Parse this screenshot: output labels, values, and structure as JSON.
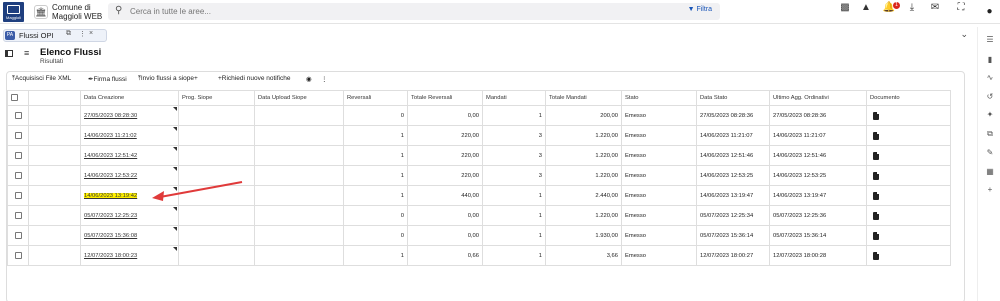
{
  "header": {
    "logo_text": "Maggioli",
    "org_line1": "Comune di",
    "org_line2": "Maggioli WEB",
    "search_placeholder": "Cerca in tutte le aree...",
    "filter_label": "Filtra",
    "notification_count": "1"
  },
  "tab": {
    "icon_text": "PA",
    "label": "Flussi OPI",
    "copy": "⧉",
    "menu": "⋮",
    "close": "×"
  },
  "page": {
    "title": "Elenco Flussi",
    "subtitle": "Risultati"
  },
  "toolbar": {
    "acquire": "Acquisisci File XML",
    "sign": "Firma flussi",
    "send": "Invio flussi a siope+",
    "request": "Richiedi nuove notifiche"
  },
  "table": {
    "columns": [
      "Data Creazione",
      "Prog. Siope",
      "Data Upload Siope",
      "Reversali",
      "Totale Reversali",
      "Mandati",
      "Totale Mandati",
      "Stato",
      "Data Stato",
      "Ultimo Agg. Ordinativi",
      "Documento"
    ],
    "rows": [
      {
        "data_creazione": "27/05/2023 08:28:30",
        "prog_siope": "",
        "data_upload": "",
        "reversali": "0",
        "tot_reversali": "0,00",
        "mandati": "1",
        "tot_mandati": "200,00",
        "stato": "Emesso",
        "data_stato": "27/05/2023 08:28:36",
        "ultimo_agg": "27/05/2023 08:28:36"
      },
      {
        "data_creazione": "14/06/2023 11:21:02",
        "prog_siope": "",
        "data_upload": "",
        "reversali": "1",
        "tot_reversali": "220,00",
        "mandati": "3",
        "tot_mandati": "1.220,00",
        "stato": "Emesso",
        "data_stato": "14/06/2023 11:21:07",
        "ultimo_agg": "14/06/2023 11:21:07"
      },
      {
        "data_creazione": "14/06/2023 12:51:42",
        "prog_siope": "",
        "data_upload": "",
        "reversali": "1",
        "tot_reversali": "220,00",
        "mandati": "3",
        "tot_mandati": "1.220,00",
        "stato": "Emesso",
        "data_stato": "14/06/2023 12:51:46",
        "ultimo_agg": "14/06/2023 12:51:46"
      },
      {
        "data_creazione": "14/06/2023 12:53:22",
        "prog_siope": "",
        "data_upload": "",
        "reversali": "1",
        "tot_reversali": "220,00",
        "mandati": "3",
        "tot_mandati": "1.220,00",
        "stato": "Emesso",
        "data_stato": "14/06/2023 12:53:25",
        "ultimo_agg": "14/06/2023 12:53:25"
      },
      {
        "data_creazione": "14/06/2023 13:19:42",
        "prog_siope": "",
        "data_upload": "",
        "reversali": "1",
        "tot_reversali": "440,00",
        "mandati": "1",
        "tot_mandati": "2.440,00",
        "stato": "Emesso",
        "data_stato": "14/06/2023 13:19:47",
        "ultimo_agg": "14/06/2023 13:19:47"
      },
      {
        "data_creazione": "05/07/2023 12:25:23",
        "prog_siope": "",
        "data_upload": "",
        "reversali": "0",
        "tot_reversali": "0,00",
        "mandati": "1",
        "tot_mandati": "1.220,00",
        "stato": "Emesso",
        "data_stato": "05/07/2023 12:25:34",
        "ultimo_agg": "05/07/2023 12:25:36"
      },
      {
        "data_creazione": "05/07/2023 15:36:08",
        "prog_siope": "",
        "data_upload": "",
        "reversali": "0",
        "tot_reversali": "0,00",
        "mandati": "1",
        "tot_mandati": "1.930,00",
        "stato": "Emesso",
        "data_stato": "05/07/2023 15:36:14",
        "ultimo_agg": "05/07/2023 15:36:14"
      },
      {
        "data_creazione": "12/07/2023 18:00:23",
        "prog_siope": "",
        "data_upload": "",
        "reversali": "1",
        "tot_reversali": "0,66",
        "mandati": "1",
        "tot_mandati": "3,66",
        "stato": "Emesso",
        "data_stato": "12/07/2023 18:00:27",
        "ultimo_agg": "12/07/2023 18:00:28"
      }
    ],
    "highlighted_row": 4
  },
  "colors": {
    "accent": "#1a56b8",
    "highlight": "#fff000",
    "annotation_arrow": "#e03a3a",
    "badge": "#d9261c"
  },
  "icons": {
    "top": [
      "dashboard-icon",
      "warning-icon",
      "bell-icon",
      "download-icon",
      "mail-icon",
      "fullscreen-icon"
    ],
    "rail": [
      "tasks-icon",
      "book-icon",
      "trend-icon",
      "history-icon",
      "pin-icon",
      "copy-icon",
      "edit-doc-icon",
      "document-icon",
      "add-icon"
    ]
  }
}
